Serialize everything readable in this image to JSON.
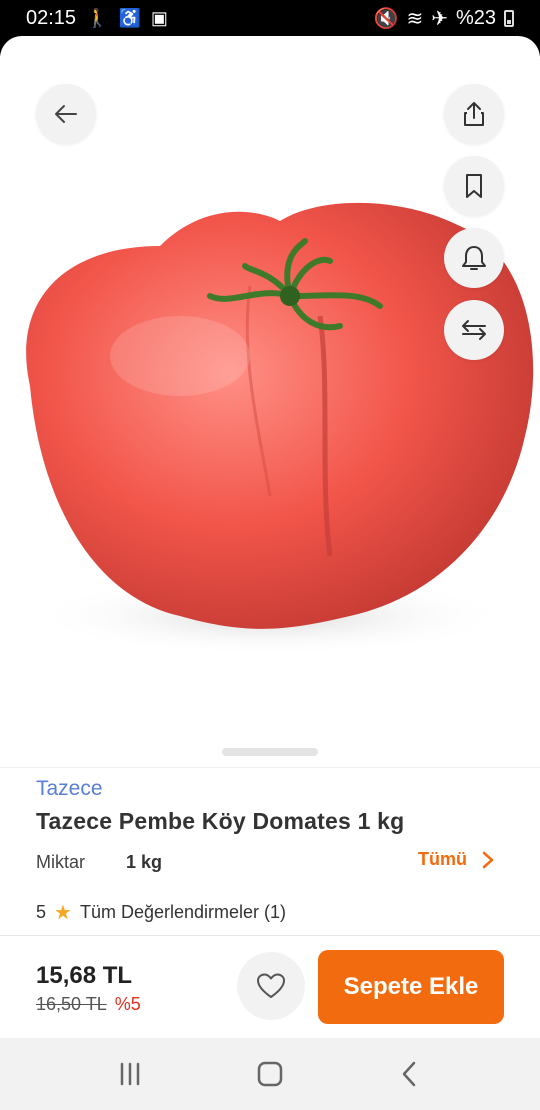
{
  "status_bar": {
    "time": "02:15",
    "battery": "%23",
    "left_icons": [
      "walk-icon",
      "accessibility-icon",
      "app-icon"
    ],
    "right_icons": [
      "mute-icon",
      "wifi-icon",
      "airplane-icon",
      "battery-icon"
    ]
  },
  "product": {
    "image": "tomato-image",
    "brand": "Tazece",
    "title": "Tazece Pembe Köy Domates 1 kg",
    "quantity_label": "Miktar",
    "quantity_value": "1 kg",
    "all_link": "Tümü",
    "rating_value": "5",
    "reviews_label": "Tüm Değerlendirmeler (1)"
  },
  "actions": {
    "back": "back-arrow-icon",
    "share": "share-icon",
    "bookmark": "bookmark-icon",
    "notify": "bell-icon",
    "compare": "compare-arrows-icon"
  },
  "purchase": {
    "price": "15,68 TL",
    "old_price": "16,50 TL",
    "discount": "%5",
    "add_to_cart": "Sepete Ekle"
  },
  "colors": {
    "accent": "#f26b0f",
    "brand_link": "#5a7fd6",
    "discount": "#e0301e",
    "star": "#f5a623"
  }
}
